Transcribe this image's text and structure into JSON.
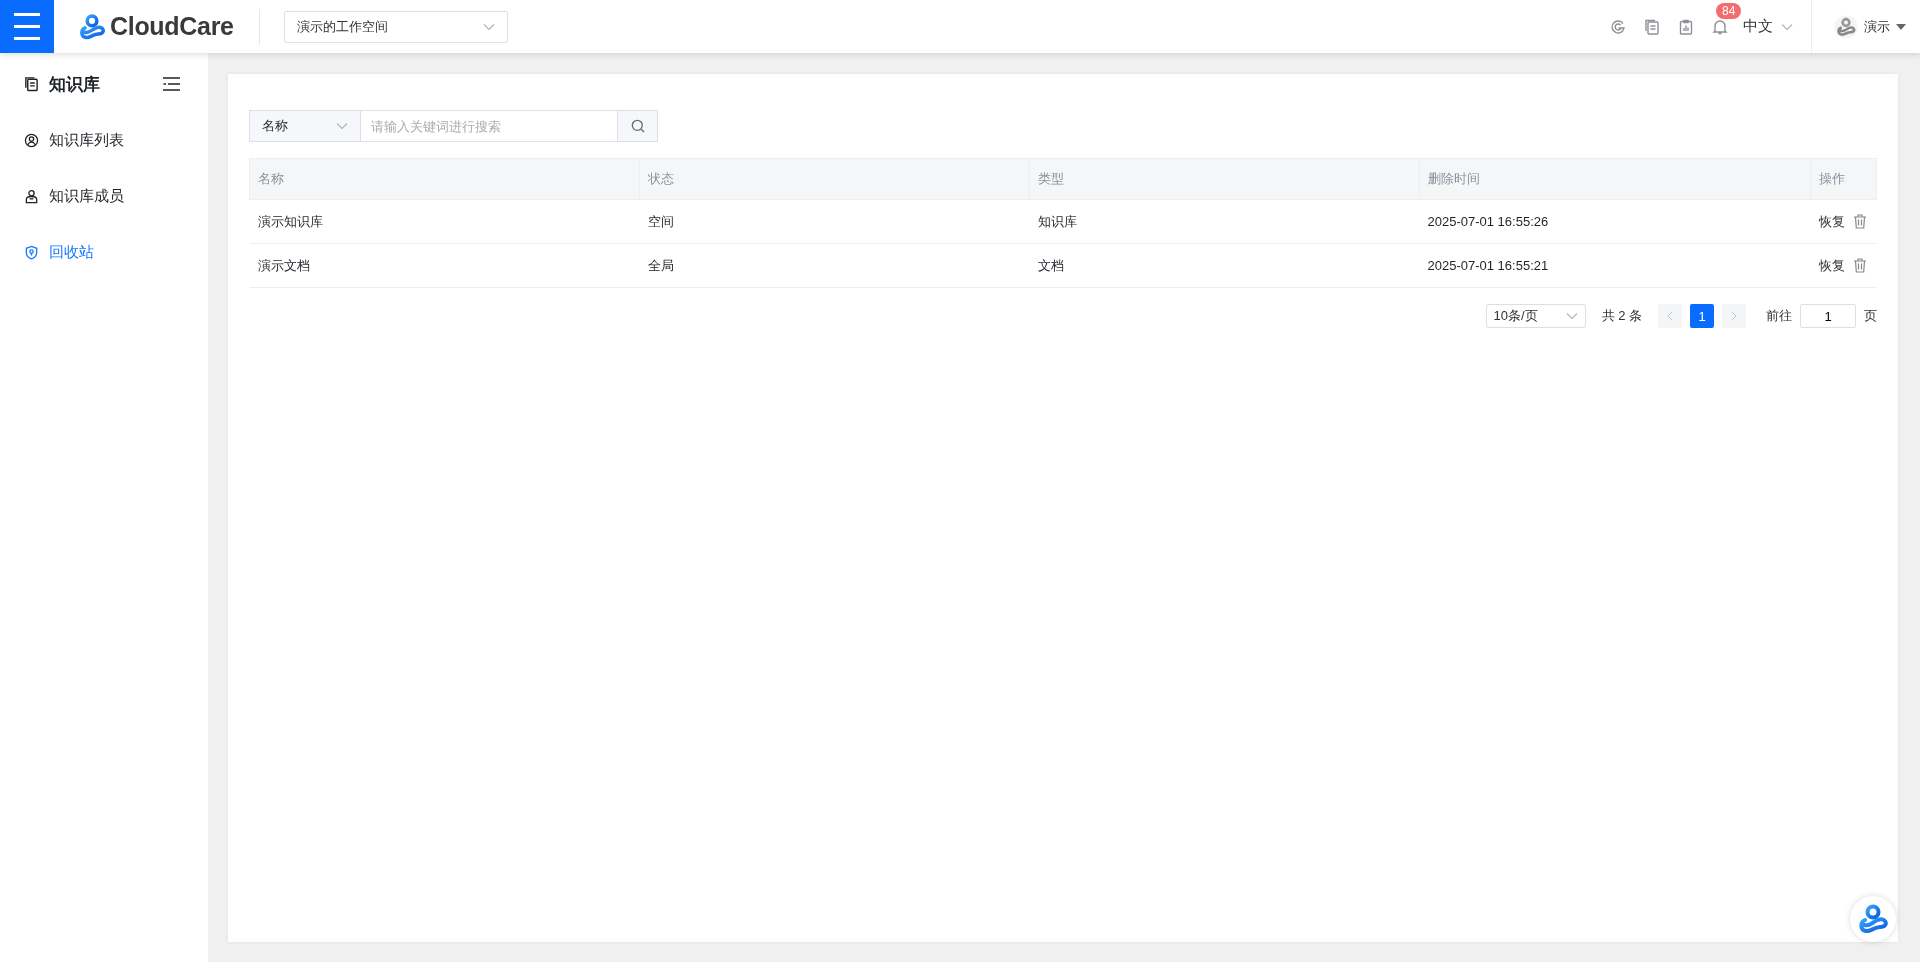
{
  "header": {
    "logo_text": "CloudCare",
    "workspace": "演示的工作空间",
    "notification_count": "84",
    "language": "中文",
    "user": "演示"
  },
  "sidebar": {
    "title": "知识库",
    "items": [
      {
        "label": "知识库列表",
        "selected": false
      },
      {
        "label": "知识库成员",
        "selected": false
      },
      {
        "label": "回收站",
        "selected": true
      }
    ]
  },
  "search": {
    "field": "名称",
    "placeholder": "请输入关键词进行搜索"
  },
  "table": {
    "columns": [
      "名称",
      "状态",
      "类型",
      "删除时间",
      "操作"
    ],
    "rows": [
      {
        "cells": [
          "演示知识库",
          "空间",
          "知识库",
          "2025-07-01 16:55:26"
        ],
        "action": "恢复"
      },
      {
        "cells": [
          "演示文档",
          "全局",
          "文档",
          "2025-07-01 16:55:21"
        ],
        "action": "恢复"
      }
    ]
  },
  "pagination": {
    "page_size": "10条/页",
    "total": "共 2 条",
    "pages": [
      {
        "label": "1",
        "selected": true
      }
    ],
    "goto_label": "前往",
    "goto_value": "1",
    "page_suffix": "页"
  }
}
